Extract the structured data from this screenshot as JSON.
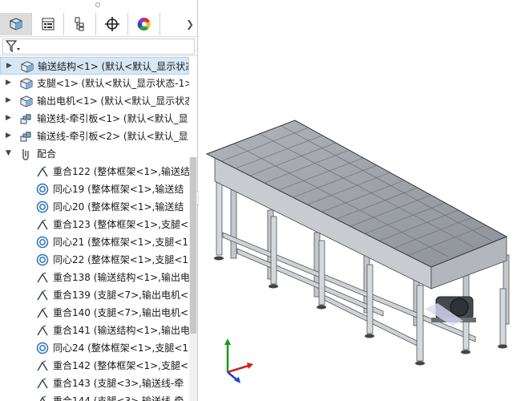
{
  "feature_tree": {
    "tabs": [
      {
        "icon": "feature-manager-icon"
      },
      {
        "icon": "property-manager-icon"
      },
      {
        "icon": "configuration-manager-icon"
      },
      {
        "icon": "dimxpert-icon"
      },
      {
        "icon": "display-manager-icon"
      }
    ],
    "filter_icon": "filter-icon",
    "items": [
      {
        "label": "输送结构<1> (默认<默认_显示状态",
        "icon": "part-icon",
        "expander": "▶",
        "selected": true
      },
      {
        "label": "支腿<1> (默认<默认_显示状态-1>",
        "icon": "part-icon",
        "expander": "▶"
      },
      {
        "label": "输出电机<1> (默认<默认_显示状态",
        "icon": "part-icon",
        "expander": "▶"
      },
      {
        "label": "输送线-牵引板<1> (默认<默认_显",
        "icon": "subassembly-icon",
        "expander": "▶"
      },
      {
        "label": "输送线-牵引板<2> (默认<默认_显",
        "icon": "subassembly-icon",
        "expander": "▶"
      },
      {
        "label": "配合",
        "icon": "mates-icon",
        "expander": "▼"
      },
      {
        "label": "重合122 (整体框架<1>,输送结",
        "icon": "coincident-icon"
      },
      {
        "label": "同心19 (整体框架<1>,输送结",
        "icon": "concentric-icon"
      },
      {
        "label": "同心20 (整体框架<1>,输送结",
        "icon": "concentric-icon"
      },
      {
        "label": "重合123 (整体框架<1>,支腿<",
        "icon": "coincident-icon"
      },
      {
        "label": "同心21 (整体框架<1>,支腿<1",
        "icon": "concentric-icon"
      },
      {
        "label": "同心22 (整体框架<1>,支腿<1",
        "icon": "concentric-icon"
      },
      {
        "label": "重合138 (输送结构<1>,输出电",
        "icon": "coincident-icon"
      },
      {
        "label": "重合139 (支腿<7>,输出电机<",
        "icon": "coincident-icon"
      },
      {
        "label": "重合140 (支腿<7>,输出电机<",
        "icon": "coincident-icon"
      },
      {
        "label": "重合141 (输送结构<1>,输出电",
        "icon": "coincident-icon"
      },
      {
        "label": "同心24 (整体框架<1>,支腿<1",
        "icon": "concentric-icon"
      },
      {
        "label": "重合142 (整体框架<1>,支腿<",
        "icon": "coincident-icon"
      },
      {
        "label": "重合143 (支腿<3>,输送线-牵",
        "icon": "coincident-icon"
      },
      {
        "label": "重合144 (支腿<3>,输送线-牵",
        "icon": "coincident-icon"
      }
    ]
  },
  "viewport": {
    "model": "conveyor-assembly-isometric",
    "triad_icon": "axis-triad-icon",
    "colors": {
      "frame": "#b8bcc4",
      "belt": "#9da1a8",
      "motor": "#44484f",
      "axis_x": "#d02020",
      "axis_y": "#10a010",
      "axis_z": "#2040d0"
    }
  }
}
